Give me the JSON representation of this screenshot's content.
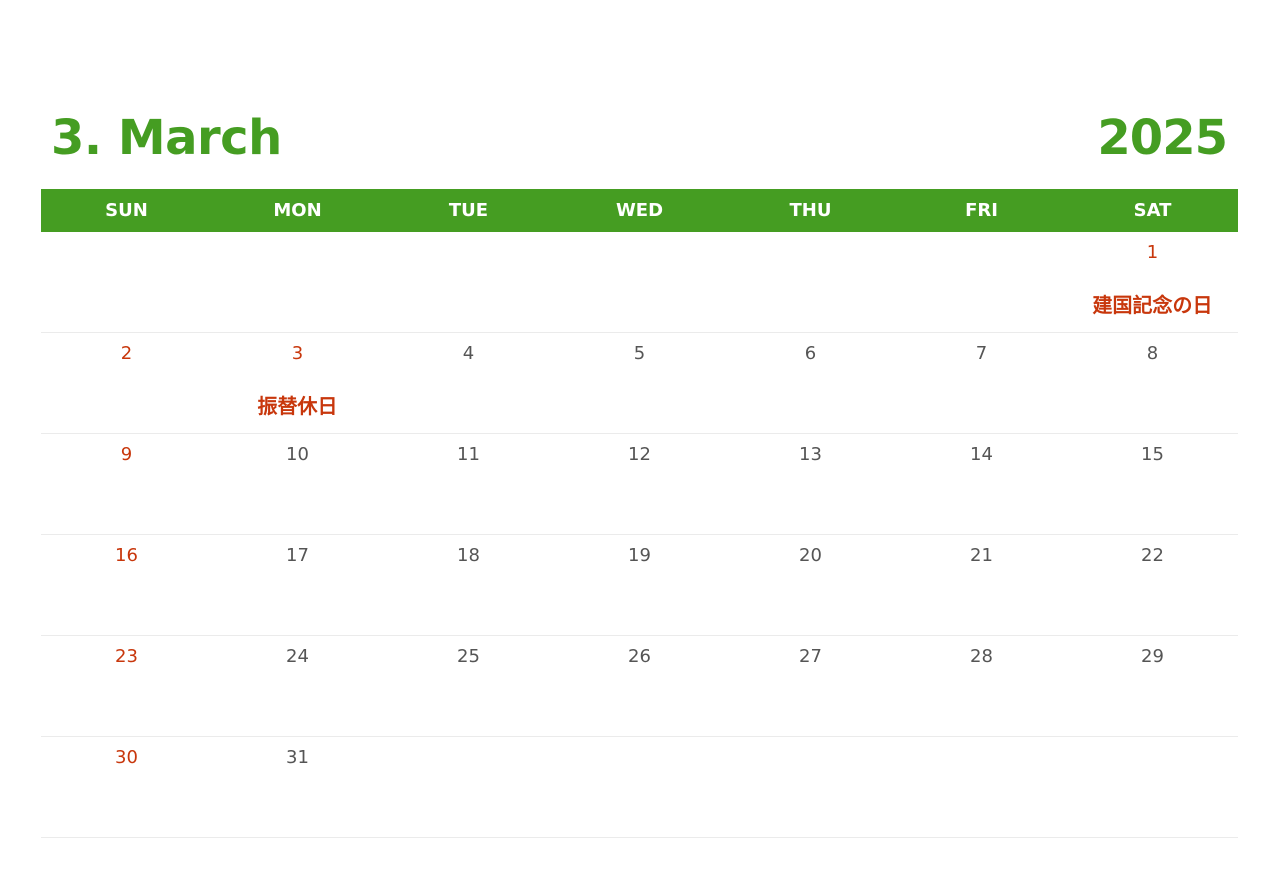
{
  "header": {
    "month_title": "3. March",
    "year": "2025"
  },
  "weekdays": [
    "SUN",
    "MON",
    "TUE",
    "WED",
    "THU",
    "FRI",
    "SAT"
  ],
  "colors": {
    "accent_green": "#459d22",
    "holiday_red": "#c8370c",
    "day_text": "#555555",
    "row_divider": "#ebebeb"
  },
  "weeks": [
    [
      {
        "day": "",
        "red": false,
        "holiday": ""
      },
      {
        "day": "",
        "red": false,
        "holiday": ""
      },
      {
        "day": "",
        "red": false,
        "holiday": ""
      },
      {
        "day": "",
        "red": false,
        "holiday": ""
      },
      {
        "day": "",
        "red": false,
        "holiday": ""
      },
      {
        "day": "",
        "red": false,
        "holiday": ""
      },
      {
        "day": "1",
        "red": true,
        "holiday": "建国記念の日"
      }
    ],
    [
      {
        "day": "2",
        "red": true,
        "holiday": ""
      },
      {
        "day": "3",
        "red": true,
        "holiday": "振替休日"
      },
      {
        "day": "4",
        "red": false,
        "holiday": ""
      },
      {
        "day": "5",
        "red": false,
        "holiday": ""
      },
      {
        "day": "6",
        "red": false,
        "holiday": ""
      },
      {
        "day": "7",
        "red": false,
        "holiday": ""
      },
      {
        "day": "8",
        "red": false,
        "holiday": ""
      }
    ],
    [
      {
        "day": "9",
        "red": true,
        "holiday": ""
      },
      {
        "day": "10",
        "red": false,
        "holiday": ""
      },
      {
        "day": "11",
        "red": false,
        "holiday": ""
      },
      {
        "day": "12",
        "red": false,
        "holiday": ""
      },
      {
        "day": "13",
        "red": false,
        "holiday": ""
      },
      {
        "day": "14",
        "red": false,
        "holiday": ""
      },
      {
        "day": "15",
        "red": false,
        "holiday": ""
      }
    ],
    [
      {
        "day": "16",
        "red": true,
        "holiday": ""
      },
      {
        "day": "17",
        "red": false,
        "holiday": ""
      },
      {
        "day": "18",
        "red": false,
        "holiday": ""
      },
      {
        "day": "19",
        "red": false,
        "holiday": ""
      },
      {
        "day": "20",
        "red": false,
        "holiday": ""
      },
      {
        "day": "21",
        "red": false,
        "holiday": ""
      },
      {
        "day": "22",
        "red": false,
        "holiday": ""
      }
    ],
    [
      {
        "day": "23",
        "red": true,
        "holiday": ""
      },
      {
        "day": "24",
        "red": false,
        "holiday": ""
      },
      {
        "day": "25",
        "red": false,
        "holiday": ""
      },
      {
        "day": "26",
        "red": false,
        "holiday": ""
      },
      {
        "day": "27",
        "red": false,
        "holiday": ""
      },
      {
        "day": "28",
        "red": false,
        "holiday": ""
      },
      {
        "day": "29",
        "red": false,
        "holiday": ""
      }
    ],
    [
      {
        "day": "30",
        "red": true,
        "holiday": ""
      },
      {
        "day": "31",
        "red": false,
        "holiday": ""
      },
      {
        "day": "",
        "red": false,
        "holiday": ""
      },
      {
        "day": "",
        "red": false,
        "holiday": ""
      },
      {
        "day": "",
        "red": false,
        "holiday": ""
      },
      {
        "day": "",
        "red": false,
        "holiday": ""
      },
      {
        "day": "",
        "red": false,
        "holiday": ""
      }
    ]
  ]
}
